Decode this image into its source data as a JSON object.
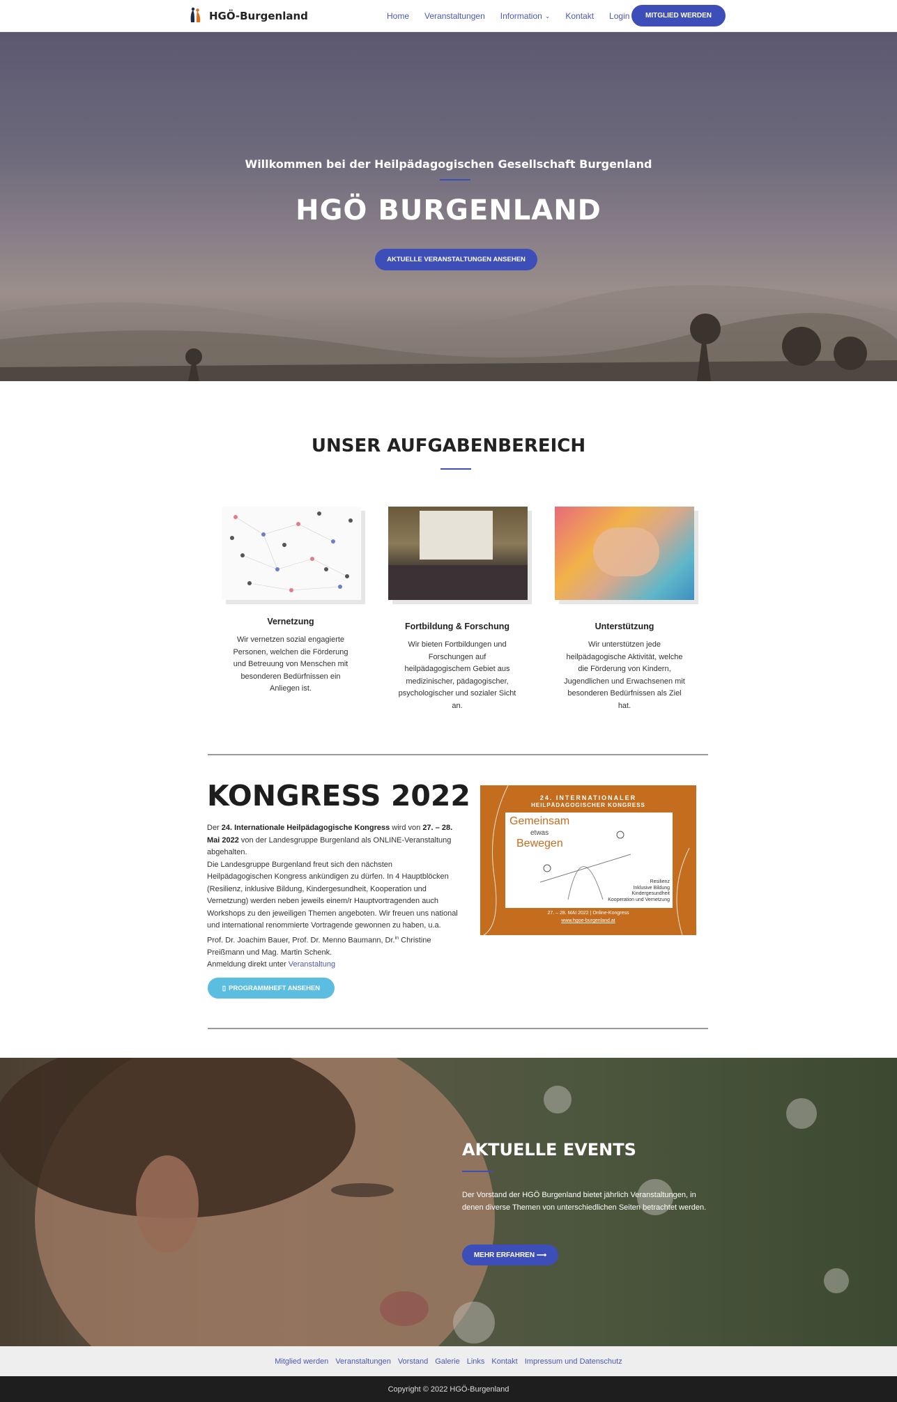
{
  "header": {
    "logo_text": "HGÖ-Burgenland",
    "nav": [
      {
        "label": "Home"
      },
      {
        "label": "Veranstaltungen"
      },
      {
        "label": "Information"
      },
      {
        "label": "Kontakt"
      },
      {
        "label": "Login"
      }
    ],
    "cta_label": "MITGLIED WERDEN"
  },
  "hero": {
    "subtitle": "Willkommen bei der Heilpädagogischen Gesellschaft Burgenland",
    "title": "HGÖ BURGENLAND",
    "button_label": "AKTUELLE VERANSTALTUNGEN ANSEHEN"
  },
  "tasks": {
    "title": "UNSER AUFGABENBEREICH",
    "cards": [
      {
        "title": "Vernetzung",
        "text": "Wir vernetzen sozial engagierte Personen, welchen die Förderung und Betreuung von Menschen mit besonderen Bedürfnissen ein Anliegen ist."
      },
      {
        "title": "Fortbildung & Forschung",
        "text": "Wir bieten Fortbildungen und Forschungen auf heilpädagogischem Gebiet aus medizinischer, pädagogischer, psychologischer und sozialer Sicht an."
      },
      {
        "title": "Unterstützung",
        "text": "Wir unterstützen jede heilpädagogische Aktivität, welche die Förderung von Kindern, Jugendlichen und Erwachsenen mit besonderen Bedürfnissen als Ziel hat."
      }
    ]
  },
  "kongress": {
    "title": "KONGRESS 2022",
    "p1_a": "Der ",
    "p1_b": "24. Internationale Heilpädagogische Kongress",
    "p1_c": " wird von ",
    "p1_d": "27. – 28. Mai 2022",
    "p1_e": " von der Landesgruppe Burgenland als ONLINE-Veranstaltung abgehalten.",
    "p2": "Die Landesgruppe Burgenland freut sich den nächsten Heilpädagogischen Kongress ankündigen zu dürfen. In 4 Hauptblöcken (Resilienz, inklusive Bildung, Kindergesundheit, Kooperation und Vernetzung) werden neben jeweils einem/r Hauptvortragenden auch Workshops zu den jeweiligen Themen angeboten. Wir freuen uns national und international renommierte Vortragende gewonnen zu haben, u.a. Prof. Dr. Joachim Bauer, Prof. Dr. Menno Baumann, Dr.",
    "p2_sup": "in",
    "p2_end": " Christine Preißmann und Mag. Martin Schenk.",
    "p3": "Anmeldung direkt unter ",
    "p3_link": "Veranstaltung",
    "button_label": "PROGRAMMHEFT ANSEHEN",
    "poster": {
      "line1": "24. INTERNATIONALER",
      "line2": "HEILPÄDAGOGISCHER KONGRESS",
      "word1": "Gemeinsam",
      "word2": "etwas",
      "word3": "Bewegen",
      "topics": [
        "Resilienz",
        "Inklusive Bildung",
        "Kindergesundheit",
        "Kooperation und Vernetzung"
      ],
      "date": "27. – 28. MAI 2022  |  Online-Kongress",
      "url": "www.hgoe-burgenland.at"
    }
  },
  "events": {
    "title": "AKTUELLE EVENTS",
    "text": "Der Vorstand der HGÖ Burgenland bietet jährlich Veranstaltungen, in denen diverse Themen von unterschiedlichen Seiten betrachtet werden.",
    "button_label": "MEHR ERFAHREN ⟶"
  },
  "footer": {
    "links": [
      "Mitglied werden",
      "Veranstaltungen",
      "Vorstand",
      "Galerie",
      "Links",
      "Kontakt",
      "Impressum und Datenschutz"
    ],
    "copyright": "Copyright © 2022 HGÖ-Burgenland"
  },
  "colors": {
    "accent": "#3e4eb8",
    "button_light": "#5bbde0",
    "poster_bg": "#c56d1f"
  }
}
